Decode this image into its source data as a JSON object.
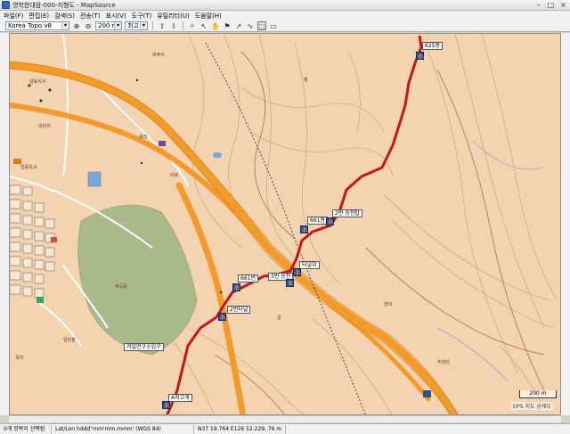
{
  "window": {
    "title": "영학한대암-000-지형도 - MapSource",
    "minimize": "–",
    "maximize": "□",
    "close": "×"
  },
  "menu": [
    "파일(F)",
    "편집(E)",
    "검색(S)",
    "전송(T)",
    "표시(V)",
    "도구(T)",
    "유틸리티(U)",
    "도움말(H)"
  ],
  "toolbar": {
    "map_product": "Korea Topo v8",
    "zoom_value": "200 m",
    "detail": "최고"
  },
  "map": {
    "scale_label": "200 m",
    "footer_note": "GPS 지도 상세도",
    "labels": {
      "summit": "625봉",
      "wp_a": "661봉",
      "wp_b": "2번 송전탑",
      "wp_c": "터널위",
      "wp_d": "661번",
      "wp_e": "3번 송전",
      "wp_f": "2번터널",
      "wp_g": "과일연구소입구",
      "start": "A지고개",
      "village": "일동초교"
    },
    "tiny_labels": [
      "파주리",
      "양동지구",
      "대원리",
      "송전",
      "봉",
      "부곡동",
      "일반분",
      "목지",
      "비봉",
      "주천리",
      "골",
      "장외"
    ]
  },
  "status": {
    "hint": "0개 항목이 선택됨",
    "format": "Lat/Lon hddd°mm'mm.mmm' (WGS 84)",
    "position": "N37 19.764 E126 52.229, 76 m"
  },
  "colors": {
    "terrain": "#f3d3b0",
    "road": "#f29a2a",
    "track": "#c8141b",
    "forest": "#a9b98a",
    "contour": "#c89a78"
  }
}
